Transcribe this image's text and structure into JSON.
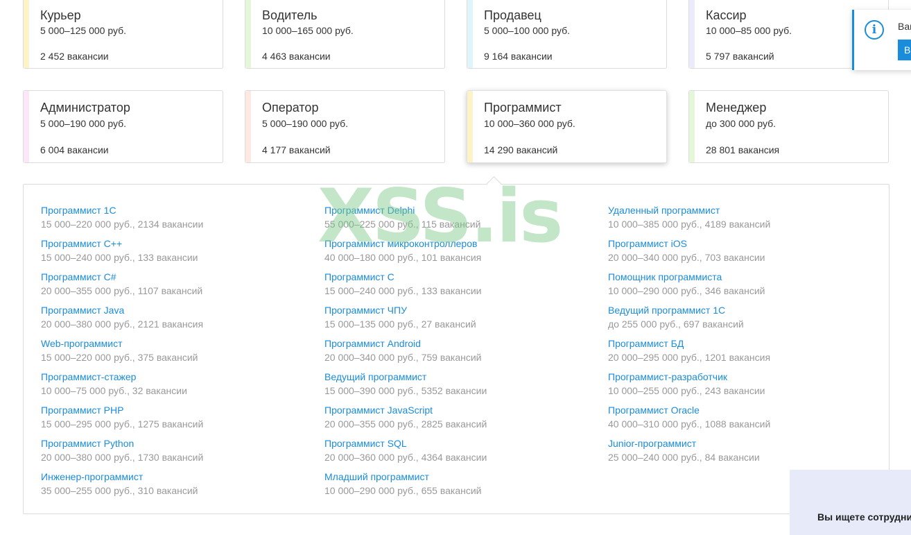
{
  "colors": {
    "link": "#1a8cdc",
    "meta": "#999999",
    "stripes": [
      "#fdf3c8",
      "#e6f7d9",
      "#dff4fb",
      "#ecebfb",
      "#fbe7f7",
      "#fde8e2",
      "#fdf3c8",
      "#e6f7d9"
    ]
  },
  "cards": [
    {
      "title": "Курьер",
      "salary": "5 000–125 000 руб.",
      "count": "2 452 вакансии"
    },
    {
      "title": "Водитель",
      "salary": "10 000–165 000 руб.",
      "count": "4 463 вакансии"
    },
    {
      "title": "Продавец",
      "salary": "5 000–100 000 руб.",
      "count": "9 164 вакансии"
    },
    {
      "title": "Кассир",
      "salary": "10 000–85 000 руб.",
      "count": "5 797 вакансий"
    },
    {
      "title": "Администратор",
      "salary": "5 000–190 000 руб.",
      "count": "6 004 вакансии"
    },
    {
      "title": "Оператор",
      "salary": "5 000–190 000 руб.",
      "count": "4 177 вакансий"
    },
    {
      "title": "Программист",
      "salary": "10 000–360 000 руб.",
      "count": "14 290 вакансий"
    },
    {
      "title": "Менеджер",
      "salary": "до 300 000 руб.",
      "count": "28 801 вакансия"
    }
  ],
  "columns": [
    [
      {
        "title": "Программист 1С",
        "meta": "15 000–220 000 руб., 2134 вакансии"
      },
      {
        "title": "Программист C++",
        "meta": "15 000–240 000 руб., 133 вакансии"
      },
      {
        "title": "Программист C#",
        "meta": "20 000–355 000 руб., 1107 вакансий"
      },
      {
        "title": "Программист Java",
        "meta": "20 000–380 000 руб., 2121 вакансия"
      },
      {
        "title": "Web-программист",
        "meta": "15 000–220 000 руб., 375 вакансий"
      },
      {
        "title": "Программист-стажер",
        "meta": "10 000–75 000 руб., 32 вакансии"
      },
      {
        "title": "Программист PHP",
        "meta": "15 000–295 000 руб., 1275 вакансий"
      },
      {
        "title": "Программист Python",
        "meta": "20 000–380 000 руб., 1730 вакансий"
      },
      {
        "title": "Инженер-программист",
        "meta": "35 000–255 000 руб., 310 вакансий"
      }
    ],
    [
      {
        "title": "Программист Delphi",
        "meta": "55 000–225 000 руб., 115 вакансий"
      },
      {
        "title": "Программист микроконтроллеров",
        "meta": "40 000–180 000 руб., 101 вакансия"
      },
      {
        "title": "Программист С",
        "meta": "15 000–240 000 руб., 133 вакансии"
      },
      {
        "title": "Программист ЧПУ",
        "meta": "15 000–135 000 руб., 27 вакансий"
      },
      {
        "title": "Программист Android",
        "meta": "20 000–340 000 руб., 759 вакансий"
      },
      {
        "title": "Ведущий программист",
        "meta": "15 000–390 000 руб., 5352 вакансии"
      },
      {
        "title": "Программист JavaScript",
        "meta": "20 000–355 000 руб., 2825 вакансий"
      },
      {
        "title": "Программист SQL",
        "meta": "20 000–360 000 руб., 4364 вакансии"
      },
      {
        "title": "Младший программист",
        "meta": "10 000–290 000 руб., 655 вакансий"
      }
    ],
    [
      {
        "title": "Удаленный программист",
        "meta": "10 000–385 000 руб., 4189 вакансий"
      },
      {
        "title": "Программист iOS",
        "meta": "20 000–340 000 руб., 703 вакансии"
      },
      {
        "title": "Помощник программиста",
        "meta": "10 000–290 000 руб., 346 вакансий"
      },
      {
        "title": "Ведущий программист 1С",
        "meta": "до 255 000 руб., 697 вакансий"
      },
      {
        "title": "Программист БД",
        "meta": "20 000–295 000 руб., 1201 вакансия"
      },
      {
        "title": "Программист-разработчик",
        "meta": "10 000–255 000 руб., 243 вакансии"
      },
      {
        "title": "Программист Oracle",
        "meta": "40 000–310 000 руб., 1088 вакансий"
      },
      {
        "title": "Junior-программист",
        "meta": "25 000–240 000 руб., 84 вакансии"
      }
    ]
  ],
  "watermark": "XSS.is",
  "notification": {
    "icon": "info-icon",
    "text": "Ваш",
    "button_label": "В"
  },
  "promo": {
    "text": "Вы ищете сотрудни"
  }
}
